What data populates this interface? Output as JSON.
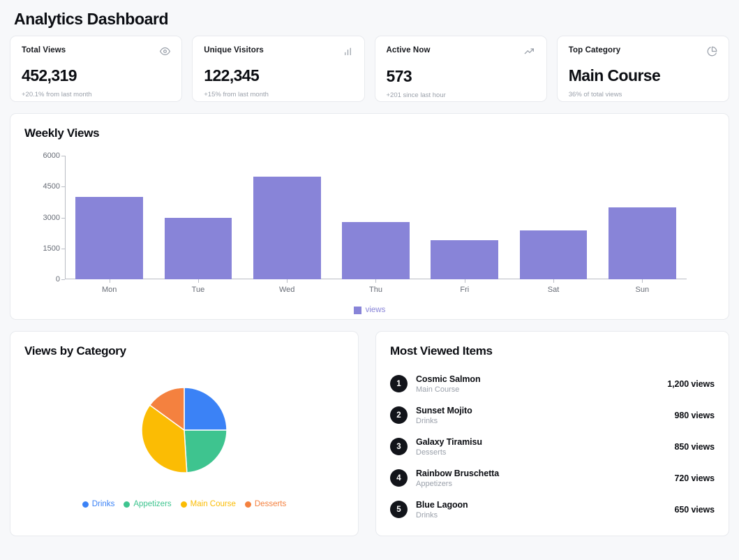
{
  "header": {
    "title": "Analytics Dashboard"
  },
  "stats": [
    {
      "label": "Total Views",
      "value": "452,319",
      "sub": "+20.1% from last month",
      "icon": "eye-icon"
    },
    {
      "label": "Unique Visitors",
      "value": "122,345",
      "sub": "+15% from last month",
      "icon": "bar-chart-icon"
    },
    {
      "label": "Active Now",
      "value": "573",
      "sub": "+201 since last hour",
      "icon": "trending-up-icon"
    },
    {
      "label": "Top Category",
      "value": "Main Course",
      "sub": "36% of total views",
      "icon": "pie-chart-icon"
    }
  ],
  "weekly": {
    "title": "Weekly Views"
  },
  "category": {
    "title": "Views by Category"
  },
  "items": {
    "title": "Most Viewed Items",
    "rows": [
      {
        "rank": "1",
        "name": "Cosmic Salmon",
        "category": "Main Course",
        "views": "1,200 views"
      },
      {
        "rank": "2",
        "name": "Sunset Mojito",
        "category": "Drinks",
        "views": "980 views"
      },
      {
        "rank": "3",
        "name": "Galaxy Tiramisu",
        "category": "Desserts",
        "views": "850 views"
      },
      {
        "rank": "4",
        "name": "Rainbow Bruschetta",
        "category": "Appetizers",
        "views": "720 views"
      },
      {
        "rank": "5",
        "name": "Blue Lagoon",
        "category": "Drinks",
        "views": "650 views"
      }
    ]
  },
  "chart_data": [
    {
      "type": "bar",
      "title": "Weekly Views",
      "categories": [
        "Mon",
        "Tue",
        "Wed",
        "Thu",
        "Fri",
        "Sat",
        "Sun"
      ],
      "series": [
        {
          "name": "views",
          "values": [
            4000,
            3000,
            5000,
            2780,
            1890,
            2390,
            3490
          ],
          "color": "#8884d8"
        }
      ],
      "xlabel": "",
      "ylabel": "",
      "ylim": [
        0,
        6000
      ],
      "yticks": [
        0,
        1500,
        3000,
        4500,
        6000
      ],
      "ytick_labels": [
        "0",
        "1500",
        "3000",
        "4500",
        "6000"
      ],
      "grid": false,
      "legend": {
        "position": "bottom",
        "entries": [
          "views"
        ]
      }
    },
    {
      "type": "pie",
      "title": "Views by Category",
      "labels": [
        "Drinks",
        "Appetizers",
        "Main Course",
        "Desserts"
      ],
      "values": [
        25,
        24,
        36,
        15
      ],
      "colors": [
        "#3b82f6",
        "#3ec48f",
        "#fbbc04",
        "#f4813f"
      ],
      "start_angle": 0,
      "legend": {
        "position": "bottom",
        "entries": [
          "Drinks",
          "Appetizers",
          "Main Course",
          "Desserts"
        ]
      }
    }
  ],
  "colors": {
    "page_bg": "#f7f8fa",
    "card_bg": "#ffffff",
    "card_border": "#e8eaee",
    "bar": "#8884d8",
    "muted_text": "#9aa0aa",
    "axis": "#b9bcc4"
  }
}
